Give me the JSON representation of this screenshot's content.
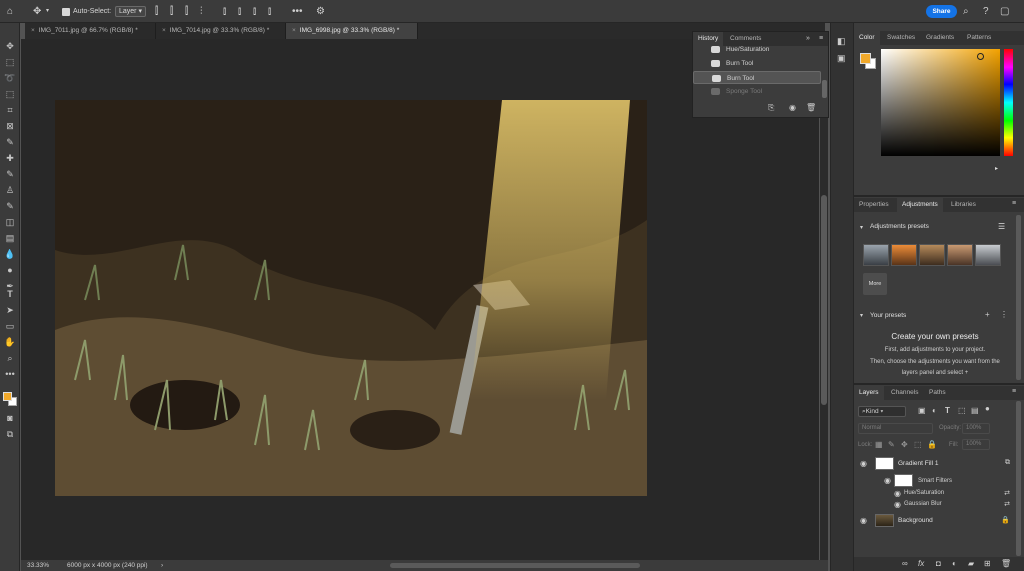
{
  "options_bar": {
    "auto_select_label": "Auto-Select:",
    "auto_select_value": "Layer",
    "share_label": "Share"
  },
  "tabs": [
    {
      "label": "IMG_7011.jpg @ 66.7% (RGB/8) *"
    },
    {
      "label": "IMG_7014.jpg @ 33.3% (RGB/8) *"
    },
    {
      "label": "IMG_6998.jpg @ 33.3% (RGB/8) *"
    }
  ],
  "history": {
    "tab_history": "History",
    "tab_comments": "Comments",
    "items": [
      "Hue/Saturation",
      "Burn Tool",
      "Burn Tool",
      "Sponge Tool"
    ]
  },
  "color_panel": {
    "tabs": [
      "Color",
      "Swatches",
      "Gradients",
      "Patterns"
    ],
    "foreground": "#f0a82a",
    "background": "#ffffff"
  },
  "adjustments": {
    "tabs": [
      "Properties",
      "Adjustments",
      "Libraries"
    ],
    "presets_title": "Adjustments presets",
    "more_label": "More",
    "your_presets_title": "Your presets",
    "create_heading": "Create your own presets",
    "create_line1": "First, add adjustments to your project.",
    "create_line2": "Then, choose the adjustments you want from the",
    "create_line3": "layers panel and select"
  },
  "layers": {
    "tabs": [
      "Layers",
      "Channels",
      "Paths"
    ],
    "kind_label": "Kind",
    "blend_mode": "Normal",
    "opacity_label": "Opacity:",
    "opacity_value": "100%",
    "lock_label": "Lock:",
    "fill_label": "Fill:",
    "fill_value": "100%",
    "items": [
      {
        "name": "Gradient Fill 1"
      },
      {
        "name": "Smart Filters"
      },
      {
        "name": "Hue/Saturation"
      },
      {
        "name": "Gaussian Blur"
      },
      {
        "name": "Background"
      }
    ]
  },
  "status": {
    "zoom": "33.33%",
    "doc_info": "6000 px x 4000 px (240 ppi)"
  }
}
